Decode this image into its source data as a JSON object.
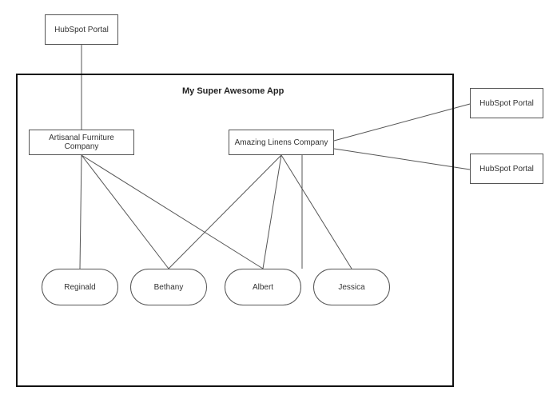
{
  "diagram": {
    "main_app_title": "My Super Awesome App",
    "hubspot_top": "HubSpot Portal",
    "hubspot_right_1": "HubSpot Portal",
    "hubspot_right_2": "HubSpot Portal",
    "company_a": "Artisanal Furniture Company",
    "company_b": "Amazing Linens Company",
    "people": {
      "reginald": "Reginald",
      "bethany": "Bethany",
      "albert": "Albert",
      "jessica": "Jessica"
    }
  }
}
